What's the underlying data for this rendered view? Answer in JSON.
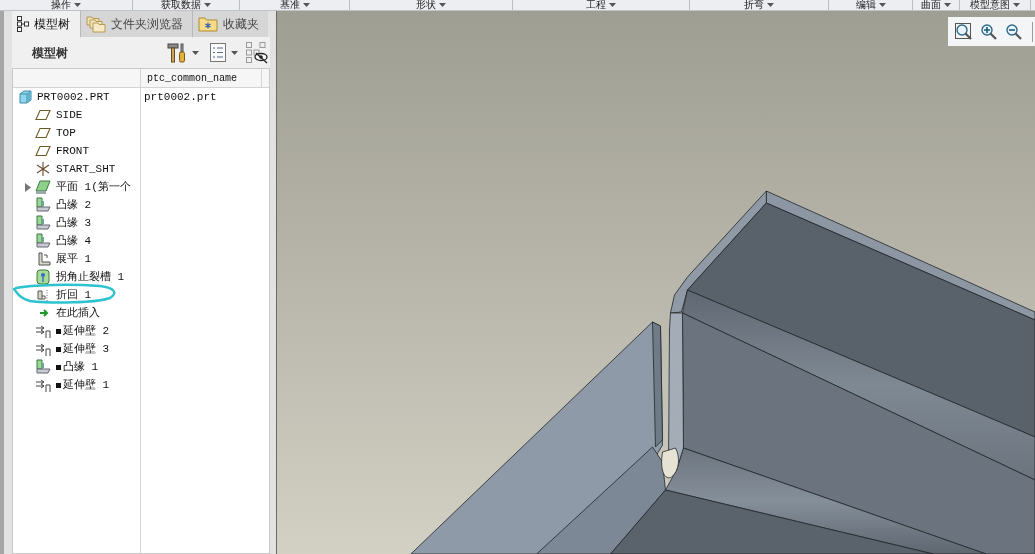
{
  "ribbon_groups": [
    "操作",
    "获取数据",
    "基准",
    "形状",
    "工程",
    "折弯",
    "编辑",
    "曲面",
    "模型意图"
  ],
  "tabs": [
    {
      "label": "模型树",
      "kind": "tree",
      "selected": true
    },
    {
      "label": "文件夹浏览器",
      "kind": "folder",
      "selected": false
    },
    {
      "label": "收藏夹",
      "kind": "favorites",
      "selected": false
    }
  ],
  "panel": {
    "title": "模型树"
  },
  "tree": {
    "columns": [
      "ptc_common_name"
    ],
    "root": {
      "label": "PRT0002.PRT",
      "kind": "part",
      "common_name": "prt0002.prt",
      "children": [
        {
          "label": "SIDE",
          "kind": "datum-plane",
          "collapsed": false,
          "suppressed": false
        },
        {
          "label": "TOP",
          "kind": "datum-plane",
          "collapsed": false,
          "suppressed": false
        },
        {
          "label": "FRONT",
          "kind": "datum-plane",
          "collapsed": false,
          "suppressed": false
        },
        {
          "label": "START_SHT",
          "kind": "csys",
          "collapsed": false,
          "suppressed": false
        },
        {
          "label": "平面 1(第一个",
          "kind": "planar-wall",
          "collapsed": true,
          "suppressed": false
        },
        {
          "label": "凸缘 2",
          "kind": "flange",
          "collapsed": false,
          "suppressed": false
        },
        {
          "label": "凸缘 3",
          "kind": "flange",
          "collapsed": false,
          "suppressed": false
        },
        {
          "label": "凸缘 4",
          "kind": "flange",
          "collapsed": false,
          "suppressed": false
        },
        {
          "label": "展平 1",
          "kind": "unbend",
          "collapsed": false,
          "suppressed": false
        },
        {
          "label": "拐角止裂槽 1",
          "kind": "corner-relief",
          "collapsed": false,
          "suppressed": false
        },
        {
          "label": "折回 1",
          "kind": "bend-back",
          "collapsed": false,
          "suppressed": false
        },
        {
          "label": "在此插入",
          "kind": "insert-here",
          "collapsed": false,
          "suppressed": false
        },
        {
          "label": "延伸壁 2",
          "kind": "extend-wall",
          "collapsed": false,
          "suppressed": true
        },
        {
          "label": "延伸壁 3",
          "kind": "extend-wall",
          "collapsed": false,
          "suppressed": true
        },
        {
          "label": "凸缘 1",
          "kind": "flange",
          "collapsed": false,
          "suppressed": true
        },
        {
          "label": "延伸壁 1",
          "kind": "extend-wall",
          "collapsed": false,
          "suppressed": true
        }
      ]
    }
  }
}
